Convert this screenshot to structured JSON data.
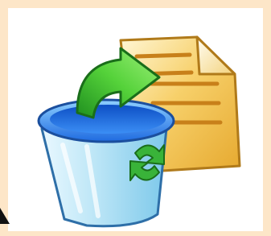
{
  "icon": {
    "name": "recycle-bin-restore-icon",
    "colors": {
      "frame": "#fde6c8",
      "background": "#ffffff",
      "document": "#f5c34f",
      "document_lines": "#c8801a",
      "bin_body": "#bfe7f7",
      "bin_rim": "#2f7ff0",
      "arrow": "#3fbf2f",
      "recycle_symbol": "#2fa82f"
    }
  }
}
